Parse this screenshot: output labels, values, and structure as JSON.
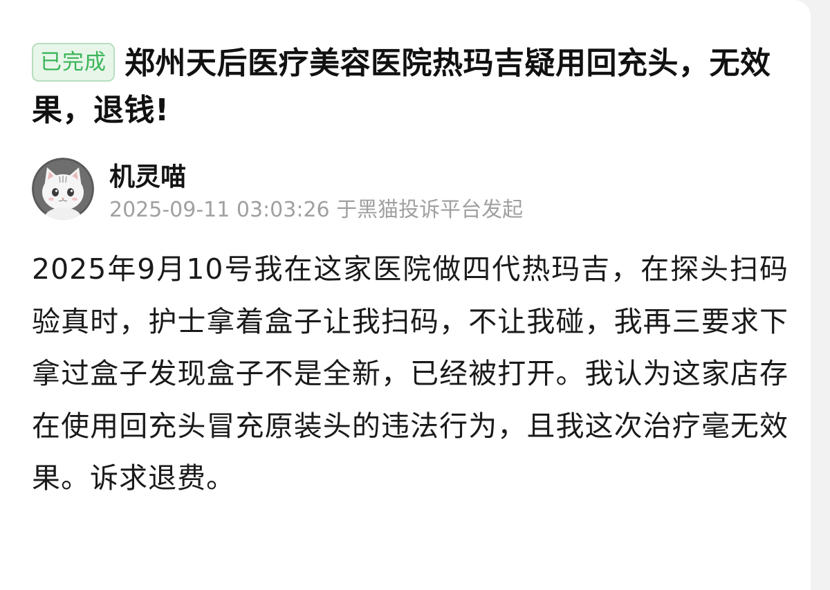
{
  "post": {
    "status_badge": "已完成",
    "title": "郑州天后医疗美容医院热玛吉疑用回充头，无效果，退钱!",
    "author": {
      "name": "机灵喵",
      "avatar_icon": "cat-avatar-icon",
      "timestamp": "2025-09-11 03:03:26",
      "source": "于黑猫投诉平台发起"
    },
    "body": "2025年9月10号我在这家医院做四代热玛吉，在探头扫码验真时，护士拿着盒子让我扫码，不让我碰，我再三要求下拿过盒子发现盒子不是全新，已经被打开。我认为这家店存在使用回充头冒充原装头的违法行为，且我这次治疗毫无效果。诉求退费。"
  },
  "colors": {
    "badge_text": "#3bb559",
    "badge_bg": "#e8f6ea",
    "badge_border": "#b5ddbe",
    "meta_text": "#a0a0a0",
    "title_text": "#111111"
  }
}
